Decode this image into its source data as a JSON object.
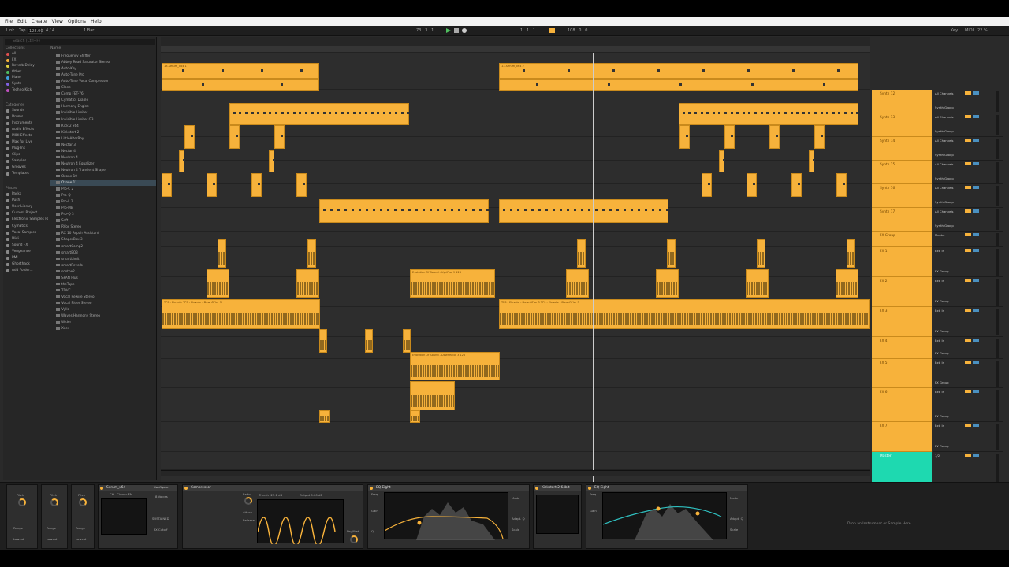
{
  "menu": [
    "File",
    "Edit",
    "Create",
    "View",
    "Options",
    "Help"
  ],
  "transport": {
    "link": "Link",
    "tap": "Tap",
    "tempo": "128.00",
    "sig": "4 / 4",
    "quant": "1 Bar",
    "position": "1 . 1 . 1",
    "end": "108 . 0 . 0",
    "key": "Key",
    "midi": "MIDI",
    "cpu": "22 %",
    "counter": "73 . 3 . 1"
  },
  "browser": {
    "search": "Search (Ctrl+F)",
    "collections_head": "Collections",
    "name_head": "Name",
    "collections": [
      {
        "label": "All",
        "color": "#e05050"
      },
      {
        "label": "FX",
        "color": "#f7b23b"
      },
      {
        "label": "Reverb Delay",
        "color": "#e0d040"
      },
      {
        "label": "Other",
        "color": "#4fbf5f"
      },
      {
        "label": "Piano",
        "color": "#40a0e0"
      },
      {
        "label": "Synth",
        "color": "#8060e0"
      },
      {
        "label": "Techno Kick",
        "color": "#c050c0"
      }
    ],
    "categories_head": "Categories",
    "categories": [
      "Sounds",
      "Drums",
      "Instruments",
      "Audio Effects",
      "MIDI Effects",
      "Max for Live",
      "Plug-Ins",
      "Clips",
      "Samples",
      "Grooves",
      "Templates"
    ],
    "places_head": "Places",
    "places": [
      "Packs",
      "Push",
      "User Library",
      "Current Project",
      "Electronic Samples Pa",
      "Cymatics",
      "Vocal Samples",
      "Midi",
      "Sound FX",
      "Vengeance",
      "PML",
      "Ghosthack",
      "Add Folder..."
    ],
    "items": [
      "Frequency Shifter",
      "Abbey Road Saturator Stereo",
      "Auto-Key",
      "Auto-Tune Pro",
      "Auto-Tune Vocal Compressor",
      "Clone",
      "Comp FET-76",
      "Cymatics Diablo",
      "Harmony Engine",
      "Invisible Limiter",
      "Invisible Limiter G3",
      "Kick 2 x64",
      "Kickstart 2",
      "LittleAlterBoy",
      "Nectar 3",
      "Nectar 4",
      "Neutron 4",
      "Neutron 4 Equalizer",
      "Neutron 4 Transient Shaper",
      "Ozone 10",
      "Ozone 11",
      "Pro-C 2",
      "Pro-Q",
      "Pro-L 2",
      "Pro-MB",
      "Pro-Q 3",
      "Soft",
      "RVox Stereo",
      "RX 10 Repair Assistant",
      "ShaperBox 3",
      "smartComp2",
      "smartEQ3",
      "smartLimit",
      "smartReverb",
      "soothe2",
      "SPAN Plus",
      "theTape",
      "TDVC",
      "Vocal Rewire Stereo",
      "Vocal Rider Stereo",
      "Vyllo",
      "Waves Harmony Stereo",
      "Wider",
      "Xees"
    ],
    "selected_index": 20
  },
  "tracks": [
    {
      "name": "Synth 12",
      "input": "All Channels",
      "group": "Synth Group"
    },
    {
      "name": "Synth 13",
      "input": "All Channels",
      "group": "Synth Group"
    },
    {
      "name": "Synth 14",
      "input": "All Channels",
      "group": "Synth Group"
    },
    {
      "name": "Synth 15",
      "input": "All Channels",
      "group": "Synth Group"
    },
    {
      "name": "Synth 16",
      "input": "All Channels",
      "group": "Synth Group"
    },
    {
      "name": "Synth 17",
      "input": "All Channels",
      "group": "Synth Group"
    },
    {
      "name": "FX Group",
      "input": "Master",
      "group": ""
    },
    {
      "name": "FX 1",
      "input": "Ext. In",
      "group": "FX Group"
    },
    {
      "name": "FX 2",
      "input": "Ext. In",
      "group": "FX Group"
    },
    {
      "name": "FX 3",
      "input": "Ext. In",
      "group": "FX Group"
    },
    {
      "name": "FX 4",
      "input": "Ext. In",
      "group": "FX Group"
    },
    {
      "name": "FX 5",
      "input": "Ext. In",
      "group": "FX Group"
    },
    {
      "name": "FX 6",
      "input": "Ext. In",
      "group": "FX Group"
    },
    {
      "name": "FX 7",
      "input": "Ext. In",
      "group": "FX Group"
    },
    {
      "name": "Master",
      "input": "1/2",
      "group": ""
    }
  ],
  "clip_labels": {
    "serum1": "13-Serum_x64 1",
    "serum2": "13-Serum_x64 2",
    "evo1": "Evolution Of Sound - UpriFlor 9 126",
    "evo_down": "Evolution Of Sound - DownRFlor 3 126",
    "tps": "TPS - Elevate TPS - Elevate - DownRFler 3",
    "tps2": "TPS - Elevate - DownRFlor 3 TPS - Elevate - DownRFler 3"
  },
  "devices": {
    "serum": "Serum_x64",
    "preset": "CH - Classic FM",
    "configure": "Configure",
    "compressor": "Compressor",
    "eq1": "EQ Eight",
    "kickstart": "Kickstart 2-64bit",
    "eq2": "EQ Eight",
    "drop_hint": "Drop an Instrument or Sample Here",
    "pitch": "Pitch",
    "range": "Range",
    "lowest": "Lowest",
    "thresh": "Thresh -25.1 dB",
    "gr": "GR",
    "output": "Output 0.00 dB",
    "ratio": "Ratio",
    "attack": "Attack",
    "release": "Release",
    "drywet": "Dry/Wet",
    "freq": "Freq",
    "gain": "Gain",
    "q": "Q",
    "mode": "Mode",
    "scale": "Scale",
    "adapt": "Adapt. Q",
    "voices": "8 Voices",
    "fx_cutoff": "FX Cutoff",
    "sustained": "SUSTAINED"
  },
  "colors": {
    "clip": "#f7b23b",
    "master": "#1ed9b0",
    "accent": "#f7b23b"
  }
}
